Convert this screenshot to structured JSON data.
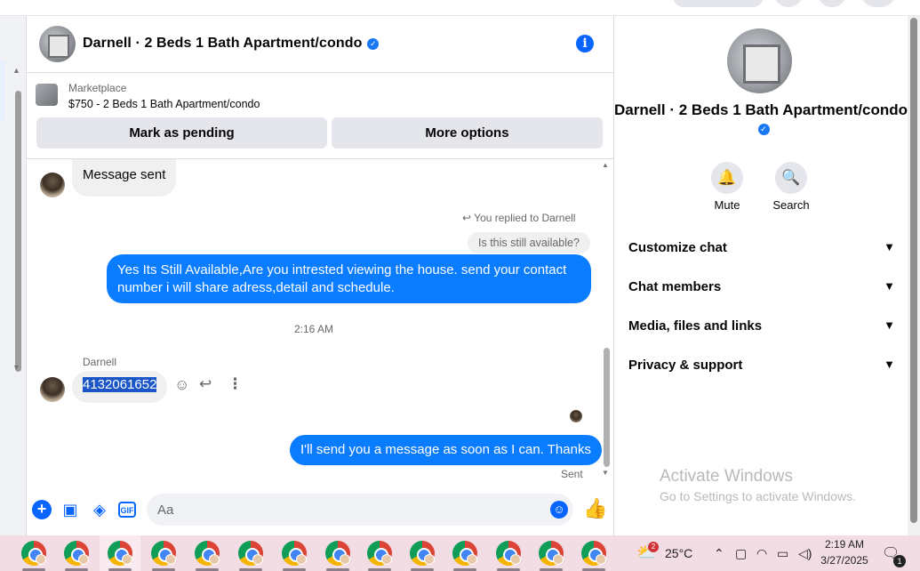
{
  "chat": {
    "title": "Darnell · 2 Beds 1 Bath Apartment/condo",
    "info_icon": "info-icon",
    "marketplace_label": "Marketplace",
    "listing": "$750 - 2 Beds 1 Bath Apartment/condo",
    "mark_pending": "Mark as pending",
    "more_options": "More options"
  },
  "messages": {
    "first_incoming": "Message sent",
    "reply_note": "You replied to Darnell",
    "reply_quote": "Is this still available?",
    "outgoing_long": "Yes Its Still Available,Are you intrested viewing the house. send your contact number i will share adress,detail and schedule.",
    "timestamp": "2:16 AM",
    "sender": "Darnell",
    "phone": "4132061652",
    "outgoing_auto": "I'll send you a message as soon as I can. Thanks",
    "sent_status": "Sent"
  },
  "composer": {
    "placeholder": "Aa",
    "gif_label": "GIF"
  },
  "right_panel": {
    "title": "Darnell · 2 Beds 1 Bath Apartment/condo",
    "mute_label": "Mute",
    "search_label": "Search",
    "rows": [
      "Customize chat",
      "Chat members",
      "Media, files and links",
      "Privacy & support"
    ]
  },
  "watermark": {
    "line1": "Activate Windows",
    "line2": "Go to Settings to activate Windows."
  },
  "taskbar": {
    "weather_badge": "2",
    "temperature": "25°C",
    "time": "2:19 AM",
    "date": "3/27/2025",
    "notification_count": "1"
  },
  "colors": {
    "accent": "#0866ff",
    "outgoing_bubble": "#0a7cff",
    "taskbar": "#f3dde4"
  }
}
